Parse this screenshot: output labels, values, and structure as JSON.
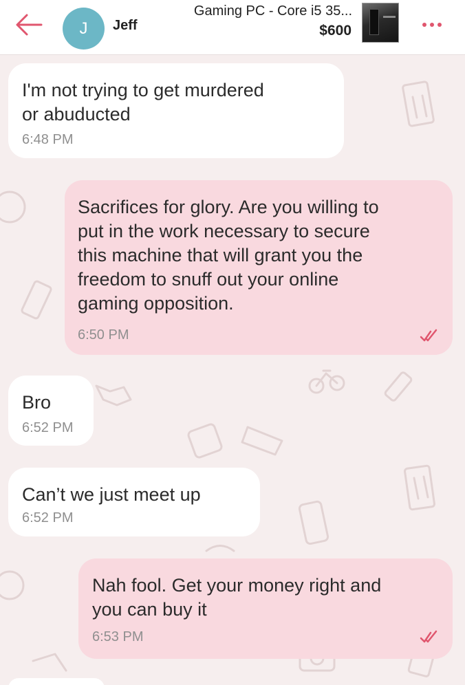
{
  "header": {
    "back_icon": "back-arrow-icon",
    "avatar_initial": "J",
    "contact_name": "Jeff",
    "listing_title": "Gaming PC - Core i5 35...",
    "listing_price": "$600",
    "more_icon": "more-dots-icon"
  },
  "colors": {
    "accent": "#e0566e",
    "avatar": "#6cb7c6",
    "outgoing_bubble": "#f9d9df",
    "incoming_bubble": "#ffffff",
    "background": "#f6eeee"
  },
  "messages": [
    {
      "direction": "incoming",
      "text": "I'm not trying to get murdered\nor abuducted",
      "time": "6:48 PM"
    },
    {
      "direction": "outgoing",
      "text": "Sacrifices for glory.  Are you willing to\nput in the work necessary to secure\nthis machine that will grant you the\nfreedom to snuff out your online\ngaming opposition.",
      "time": "6:50 PM",
      "status_icon": "read-check-icon"
    },
    {
      "direction": "incoming",
      "text": "Bro",
      "time": "6:52 PM"
    },
    {
      "direction": "incoming",
      "text": "Can’t we just meet up",
      "time": "6:52 PM"
    },
    {
      "direction": "outgoing",
      "text": "Nah fool.  Get your money right and\nyou can buy it",
      "time": "6:53 PM",
      "status_icon": "read-check-icon"
    }
  ]
}
